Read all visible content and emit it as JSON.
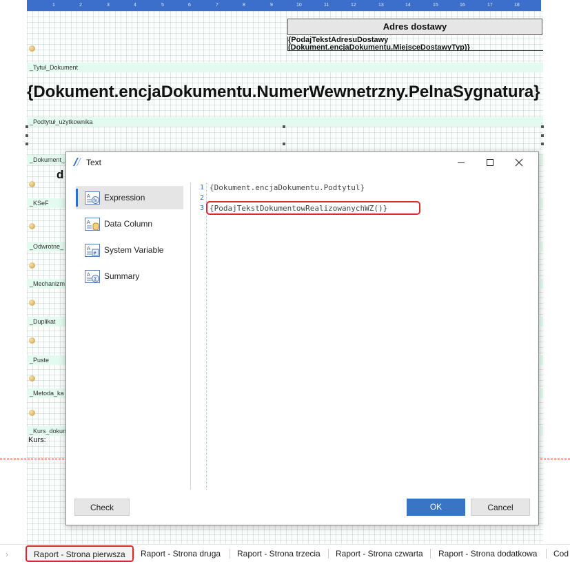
{
  "designer": {
    "ruler_marks": [
      "1",
      "2",
      "3",
      "4",
      "5",
      "6",
      "7",
      "8",
      "9",
      "10",
      "11",
      "12",
      "13",
      "14",
      "15",
      "16",
      "17",
      "18"
    ],
    "delivery_address_header": "Adres dostawy",
    "delivery_address_line1": "{PodajTekstAdresuDostawy",
    "delivery_address_line2": "(Dokument.encjaDokumentu.MiejsceDostawyTyp)}",
    "main_title": "{Dokument.encjaDokumentu.NumerWewnetrzny.PelnaSygnatura}",
    "partial_text": "d",
    "kurs_label": "Kurs:",
    "bands": [
      {
        "label": "_Tytuł_Dokument"
      },
      {
        "label": "_Podtytuł_użytkownika"
      },
      {
        "label": "_Dokument_"
      },
      {
        "label": "_KSeF"
      },
      {
        "label": "_Odwrotne_"
      },
      {
        "label": "_Mechanizm"
      },
      {
        "label": "_Duplikat"
      },
      {
        "label": "_Puste"
      },
      {
        "label": "_Metoda_ka"
      },
      {
        "label": "_Kurs_dokun"
      }
    ]
  },
  "dialog": {
    "title": "Text",
    "sidebar": [
      {
        "label": "Expression",
        "icon": "expression-icon",
        "active": true
      },
      {
        "label": "Data Column",
        "icon": "data-column-icon",
        "active": false
      },
      {
        "label": "System Variable",
        "icon": "system-variable-icon",
        "active": false
      },
      {
        "label": "Summary",
        "icon": "summary-icon",
        "active": false
      }
    ],
    "editor_lines": [
      {
        "num": "1",
        "text": "{Dokument.encjaDokumentu.Podtytul}"
      },
      {
        "num": "2",
        "text": ""
      },
      {
        "num": "3",
        "text": "{PodajTekstDokumentowRealizowanychWZ()}"
      }
    ],
    "buttons": {
      "check": "Check",
      "ok": "OK",
      "cancel": "Cancel"
    }
  },
  "tabs": [
    {
      "label": "Raport - Strona pierwsza",
      "active": true
    },
    {
      "label": "Raport - Strona druga",
      "active": false
    },
    {
      "label": "Raport - Strona trzecia",
      "active": false
    },
    {
      "label": "Raport - Strona czwarta",
      "active": false
    },
    {
      "label": "Raport - Strona dodatkowa",
      "active": false
    },
    {
      "label": "Cod",
      "active": false
    }
  ],
  "colors": {
    "accent": "#3a74c4",
    "highlight": "#e0262e",
    "band": "#e3fbee",
    "ruler": "#3c6fcc"
  }
}
